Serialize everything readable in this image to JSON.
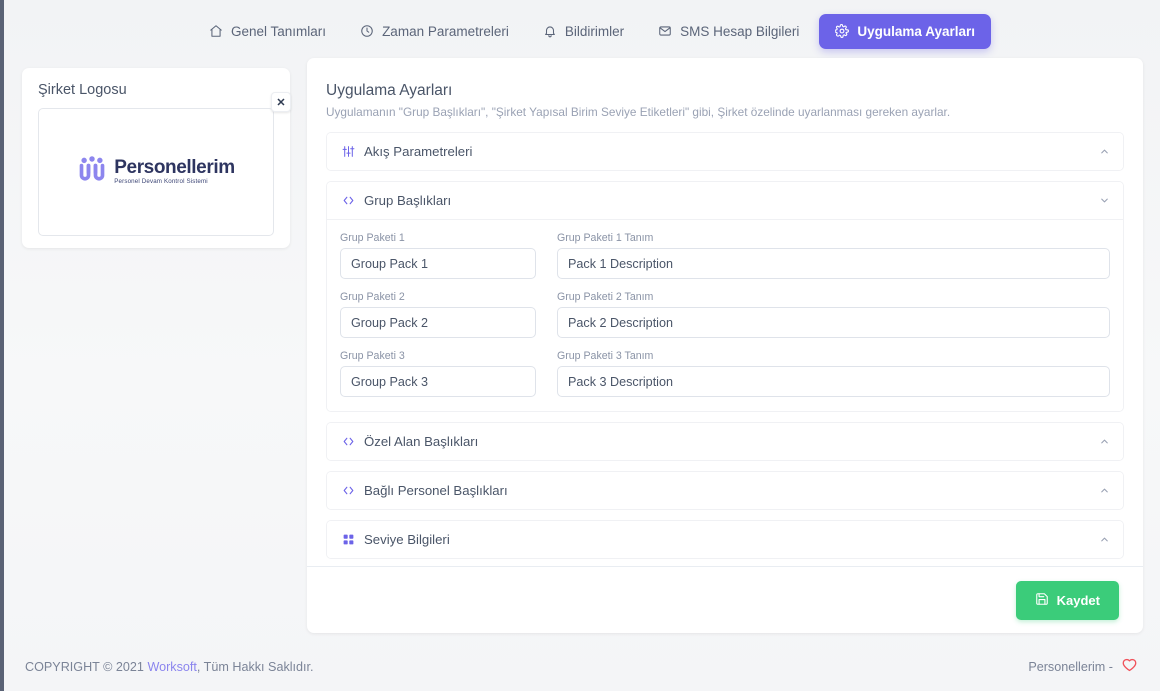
{
  "nav": {
    "items": [
      {
        "label": "Genel Tanımları",
        "icon": "home-icon",
        "active": false
      },
      {
        "label": "Zaman Parametreleri",
        "icon": "clock-icon",
        "active": false
      },
      {
        "label": "Bildirimler",
        "icon": "bell-icon",
        "active": false
      },
      {
        "label": "SMS Hesap Bilgileri",
        "icon": "mail-icon",
        "active": false
      },
      {
        "label": "Uygulama Ayarları",
        "icon": "gear-icon",
        "active": true
      }
    ]
  },
  "logo_panel": {
    "title": "Şirket Logosu",
    "close_label": "✕",
    "brand_name": "Personellerim",
    "brand_tagline": "Personel Devam Kontrol Sistemi"
  },
  "main": {
    "title": "Uygulama Ayarları",
    "subtitle": "Uygulamanın \"Grup Başlıkları\", \"Şirket Yapısal Birim Seviye Etiketleri\" gibi, Şirket özelinde uyarlanması gereken ayarlar.",
    "sections": [
      {
        "label": "Akış Parametreleri",
        "icon": "sliders-icon",
        "expanded": false,
        "chevron": "chevron-up-icon"
      },
      {
        "label": "Grup Başlıkları",
        "icon": "code-icon",
        "expanded": true,
        "chevron": "chevron-down-icon"
      },
      {
        "label": "Özel Alan Başlıkları",
        "icon": "code-icon",
        "expanded": false,
        "chevron": "chevron-up-icon"
      },
      {
        "label": "Bağlı Personel Başlıkları",
        "icon": "code-icon",
        "expanded": false,
        "chevron": "chevron-up-icon"
      },
      {
        "label": "Seviye Bilgileri",
        "icon": "grid-icon",
        "expanded": false,
        "chevron": "chevron-up-icon"
      }
    ],
    "group_fields": [
      {
        "name_label": "Grup Paketi 1",
        "name_value": "Group Pack 1",
        "desc_label": "Grup Paketi 1 Tanım",
        "desc_value": "Pack 1 Description"
      },
      {
        "name_label": "Grup Paketi 2",
        "name_value": "Group Pack 2",
        "desc_label": "Grup Paketi 2 Tanım",
        "desc_value": "Pack 2 Description"
      },
      {
        "name_label": "Grup Paketi 3",
        "name_value": "Group Pack 3",
        "desc_label": "Grup Paketi 3 Tanım",
        "desc_value": "Pack 3 Description"
      }
    ],
    "save_label": "Kaydet",
    "save_icon": "save-icon"
  },
  "footer": {
    "copyright_prefix": "COPYRIGHT © 2021",
    "link": "Worksoft",
    "copyright_suffix": ", Tüm Hakkı Saklıdır.",
    "right_text": "Personellerim -",
    "heart_icon": "heart-icon"
  },
  "colors": {
    "accent": "#6c63e8",
    "save": "#3bcc7a",
    "heart": "#f0525b",
    "page_bg": "#f4f5f7",
    "brand_dark": "#2e3560"
  }
}
